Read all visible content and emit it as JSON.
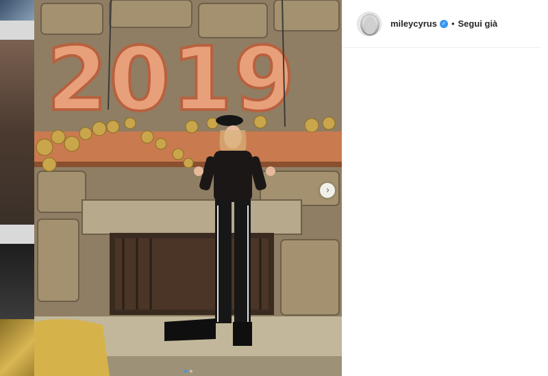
{
  "post": {
    "username": "mileycyrus",
    "separator": "•",
    "follow_label": "Segui già",
    "verified_icon": "verified-badge-icon",
    "next_icon": "chevron-right-icon",
    "next_glyph": "›",
    "carousel_total": 2,
    "carousel_active": 1,
    "photo_text": "2019"
  },
  "colors": {
    "accent": "#3897f0",
    "text": "#262626",
    "divider": "#efefef"
  }
}
